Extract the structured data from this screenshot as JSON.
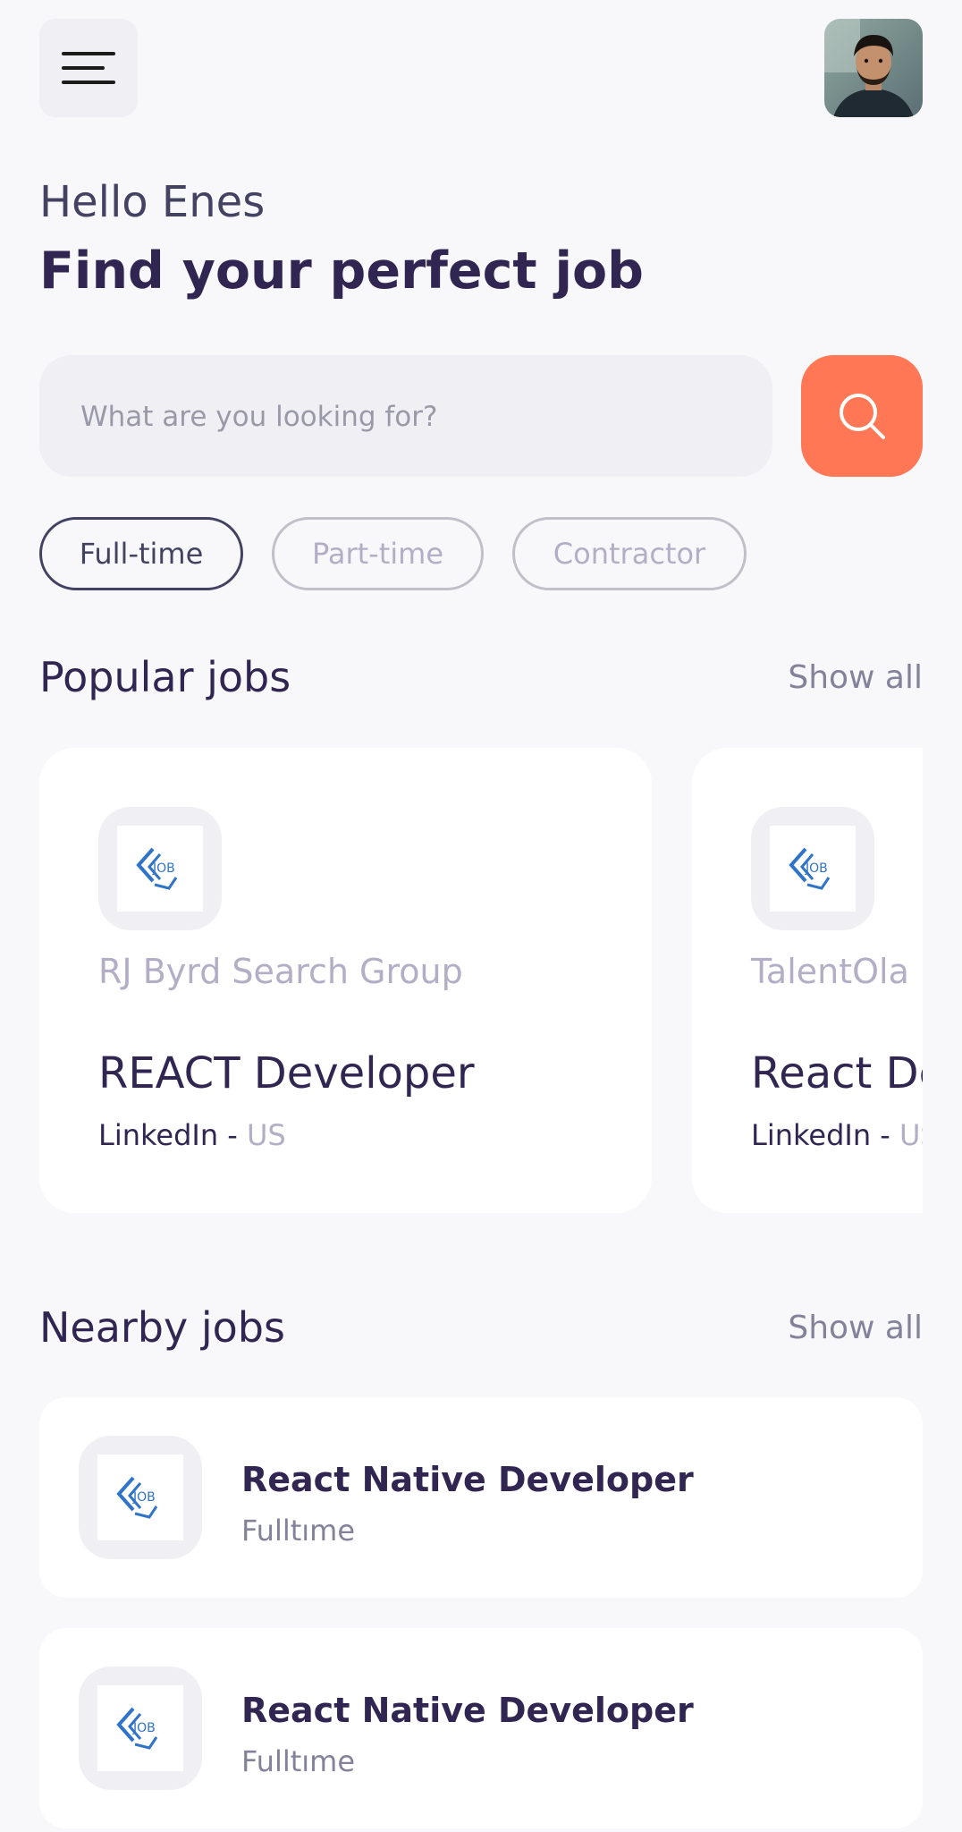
{
  "header": {
    "menu_icon": "hamburger-menu-icon",
    "avatar_icon": "profile-photo"
  },
  "welcome": {
    "greeting": "Hello Enes",
    "headline": "Find your perfect job"
  },
  "search": {
    "placeholder": "What are you looking for?",
    "value": "",
    "button_icon": "search-icon",
    "accent_color": "#FF7754"
  },
  "job_types": [
    {
      "label": "Full-time",
      "active": true
    },
    {
      "label": "Part-time",
      "active": false
    },
    {
      "label": "Contractor",
      "active": false
    }
  ],
  "popular": {
    "title": "Popular jobs",
    "show_all": "Show all",
    "cards": [
      {
        "logo_icon": "job-logo-icon",
        "company": "RJ Byrd Search Group",
        "title": "REACT Developer",
        "publisher": "LinkedIn",
        "separator": " - ",
        "country": "US"
      },
      {
        "logo_icon": "job-logo-icon",
        "company": "TalentOla",
        "title": "React Developer",
        "publisher": "LinkedIn",
        "separator": " - ",
        "country": "US"
      }
    ]
  },
  "nearby": {
    "title": "Nearby jobs",
    "show_all": "Show all",
    "items": [
      {
        "logo_icon": "job-logo-icon",
        "title": "React Native Developer",
        "type": "Fulltıme"
      },
      {
        "logo_icon": "job-logo-icon",
        "title": "React Native Developer",
        "type": "Fulltıme"
      }
    ]
  },
  "colors": {
    "primary": "#312651",
    "tertiary": "#FF7754",
    "gray": "#83829A",
    "background": "#F8F8FB"
  }
}
